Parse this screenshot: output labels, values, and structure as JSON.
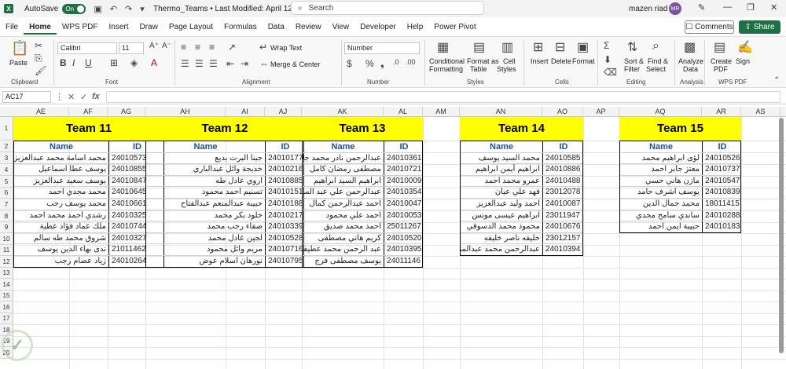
{
  "titlebar": {
    "app_icon": "excel-icon",
    "autosave_label": "AutoSave",
    "autosave_state": "On",
    "title": "Thermo_Teams • Last Modified: April 12",
    "search_placeholder": "Search",
    "user_name": "mazen riad",
    "user_initials": "MR"
  },
  "menus": [
    "File",
    "Home",
    "WPS PDF",
    "Insert",
    "Draw",
    "Page Layout",
    "Formulas",
    "Data",
    "Review",
    "View",
    "Developer",
    "Help",
    "Power Pivot"
  ],
  "active_menu": "Home",
  "actions": {
    "comments": "Comments",
    "share": "Share"
  },
  "ribbon": {
    "clipboard": {
      "paste": "Paste",
      "label": "Clipboard"
    },
    "font": {
      "name": "Calibri",
      "size": "11",
      "label": "Font"
    },
    "alignment": {
      "wrap": "Wrap Text",
      "merge": "Merge & Center",
      "label": "Alignment"
    },
    "number": {
      "format": "Number",
      "label": "Number"
    },
    "styles": {
      "conditional": "Conditional",
      "conditional2": "Formatting",
      "format_as": "Format as",
      "format_as2": "Table",
      "cell": "Cell",
      "cell2": "Styles",
      "label": "Styles"
    },
    "cells": {
      "insert": "Insert",
      "delete": "Delete",
      "format": "Format",
      "label": "Cells"
    },
    "editing": {
      "sort": "Sort &",
      "sort2": "Filter",
      "find": "Find &",
      "find2": "Select",
      "label": "Editing"
    },
    "analysis": {
      "analyze": "Analyze",
      "analyze2": "Data",
      "label": "Analysis"
    },
    "wpspdf": {
      "create": "Create",
      "create2": "PDF",
      "sign": "Sign",
      "label": "WPS PDF"
    }
  },
  "formula_bar": {
    "cell_ref": "AC17",
    "fx": "fx",
    "content": ""
  },
  "columns": [
    "AE",
    "AF",
    "AG",
    "AH",
    "AI",
    "AJ",
    "AK",
    "AL",
    "AM",
    "AN",
    "AO",
    "AP",
    "AQ",
    "AR",
    "AS"
  ],
  "rows": [
    "1",
    "2",
    "3",
    "4",
    "5",
    "6",
    "7",
    "8",
    "9",
    "10",
    "11",
    "12",
    "13",
    "14",
    "15",
    "16",
    "17",
    "18",
    "19",
    "20"
  ],
  "teams": [
    {
      "title": "Team 11",
      "name_header": "Name",
      "id_header": "ID",
      "members": [
        {
          "name": "محمد اسامة محمد عبدالعزيز",
          "id": "24010573"
        },
        {
          "name": "يوسف عطا اسماعيل",
          "id": "24010855"
        },
        {
          "name": "يوسف سعيد عبدالعزيز",
          "id": "24010847"
        },
        {
          "name": "محمد مجدي احمد",
          "id": "24010645"
        },
        {
          "name": "محمد يوسف رجب",
          "id": "24010661"
        },
        {
          "name": "رشدي احمد محمد احمد",
          "id": "24010325"
        },
        {
          "name": "ملك عماد فؤاد عطية",
          "id": "24010744"
        },
        {
          "name": "شروق محمد طه سالم",
          "id": "24010327"
        },
        {
          "name": "ندى بهاء الدين يوسف",
          "id": "21011462"
        },
        {
          "name": "زياد عصام رجب",
          "id": "24010264"
        }
      ]
    },
    {
      "title": "Team 12",
      "name_header": "Name",
      "id_header": "ID",
      "members": [
        {
          "name": "جينا البرت بديع",
          "id": "24010177"
        },
        {
          "name": "خديجة وائل عبدالباري",
          "id": "24010216"
        },
        {
          "name": "اروي عادل طه",
          "id": "24010885"
        },
        {
          "name": "تسنيم احمد محمود",
          "id": "24010151"
        },
        {
          "name": "حبيبة عبدالمنعم عبدالفتاح",
          "id": "24010188"
        },
        {
          "name": "خلود بكر محمد",
          "id": "24010217"
        },
        {
          "name": "صفاء رجب محمد",
          "id": "24010339"
        },
        {
          "name": "لجين عادل محمد",
          "id": "24010528"
        },
        {
          "name": "مريم وائل محمود",
          "id": "24010716"
        },
        {
          "name": "نورهان اسلام عوض",
          "id": "24010795"
        }
      ]
    },
    {
      "title": "Team 13",
      "name_header": "Name",
      "id_header": "ID",
      "members": [
        {
          "name": "عبدالرحمن نادر محمد جلال",
          "id": "24010361"
        },
        {
          "name": "مصطفى رمضان كامل",
          "id": "24010721"
        },
        {
          "name": "ابراهيم السيد ابراهيم",
          "id": "24010009"
        },
        {
          "name": "عبدالرحمن علي عبد السلام",
          "id": "24010354"
        },
        {
          "name": "احمد عبدالرحمن كمال",
          "id": "24010047"
        },
        {
          "name": "احمد علي محمود",
          "id": "24010053"
        },
        {
          "name": "احمد محمد صديق",
          "id": "25011267"
        },
        {
          "name": "كريم هاني مصطفى",
          "id": "24010520"
        },
        {
          "name": "عبد الرحمن محمد عطيفي",
          "id": "24010395"
        },
        {
          "name": "يوسف مصطفى فرج",
          "id": "24011146"
        }
      ]
    },
    {
      "title": "Team 14",
      "name_header": "Name",
      "id_header": "ID",
      "members": [
        {
          "name": "محمد السيد يوسف",
          "id": "24010585"
        },
        {
          "name": "ابراهيم أيمن ابراهيم",
          "id": "24010886"
        },
        {
          "name": "عمرو محمد احمد",
          "id": "24010488"
        },
        {
          "name": "فهد علي عيان",
          "id": "23012078"
        },
        {
          "name": "احمد وليد عبدالعزيز",
          "id": "24010087"
        },
        {
          "name": "ابراهيم عيسى مونس",
          "id": "23011947"
        },
        {
          "name": "محمود محمد الدسوقي",
          "id": "24010676"
        },
        {
          "name": "خليفه ناصر خليفه",
          "id": "23012157"
        },
        {
          "name": "عبدالرحمن محمد عبدالمنعم",
          "id": "24010394"
        }
      ]
    },
    {
      "title": "Team 15",
      "name_header": "Name",
      "id_header": "ID",
      "members": [
        {
          "name": "لؤى ابراهيم محمد",
          "id": "24010526"
        },
        {
          "name": "معتز جابر احمد",
          "id": "24010737"
        },
        {
          "name": "مازن هاني حسي",
          "id": "24010547"
        },
        {
          "name": "يوسف اشرف حامد",
          "id": "24010839"
        },
        {
          "name": "محمد جمال الدين",
          "id": "18011415"
        },
        {
          "name": "ساندي سامح مجدي",
          "id": "24010288"
        },
        {
          "name": "حبيبة ايمن احمد",
          "id": "24010183"
        }
      ]
    }
  ],
  "colors": {
    "brand": "#1e7145",
    "header_fill": "#ffff00",
    "header_text": "#1f4e9a"
  }
}
